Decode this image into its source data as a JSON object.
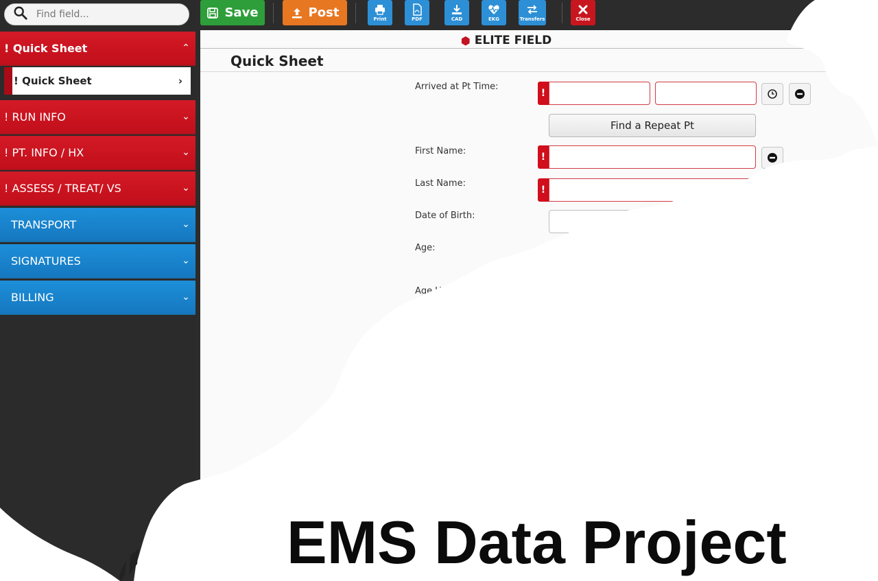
{
  "search": {
    "placeholder": "Find field..."
  },
  "sidebar": {
    "sections": [
      {
        "label": "! Quick Sheet",
        "chevron": "⌃"
      },
      {
        "label": "! RUN INFO",
        "chevron": "⌄"
      },
      {
        "label": "! PT. INFO / HX",
        "chevron": "⌄"
      },
      {
        "label": "! ASSESS / TREAT/ VS",
        "chevron": "⌄"
      },
      {
        "label": "TRANSPORT",
        "chevron": "⌄"
      },
      {
        "label": "SIGNATURES",
        "chevron": "⌄"
      },
      {
        "label": "BILLING",
        "chevron": "⌄"
      }
    ],
    "subitem": {
      "label": "! Quick Sheet",
      "chevron": "›"
    }
  },
  "toolbar": {
    "save_label": "Save",
    "post_label": "Post",
    "print_label": "Print",
    "pdf_label": "PDF",
    "cad_label": "CAD",
    "ekg_label": "EKG",
    "transfers_label": "Transfers",
    "close_label": "Close"
  },
  "colors": {
    "save": "#2e9e3a",
    "post": "#e87722",
    "tool": "#2d8fd5",
    "close": "#c8161f",
    "required": "#d00e1c",
    "section_red": "#c9141f",
    "section_blue": "#1a83cc"
  },
  "brand": {
    "name": "ELITE FIELD"
  },
  "form": {
    "title": "Quick Sheet",
    "arrived_label": "Arrived at Pt Time:",
    "repeat_button": "Find a Repeat Pt",
    "first_name_label": "First Name:",
    "last_name_label": "Last Name:",
    "dob_label": "Date of Birth:",
    "age_label": "Age:",
    "age_units_label": "Age U",
    "required_mark": "!"
  },
  "headline": "EMS Data Project"
}
